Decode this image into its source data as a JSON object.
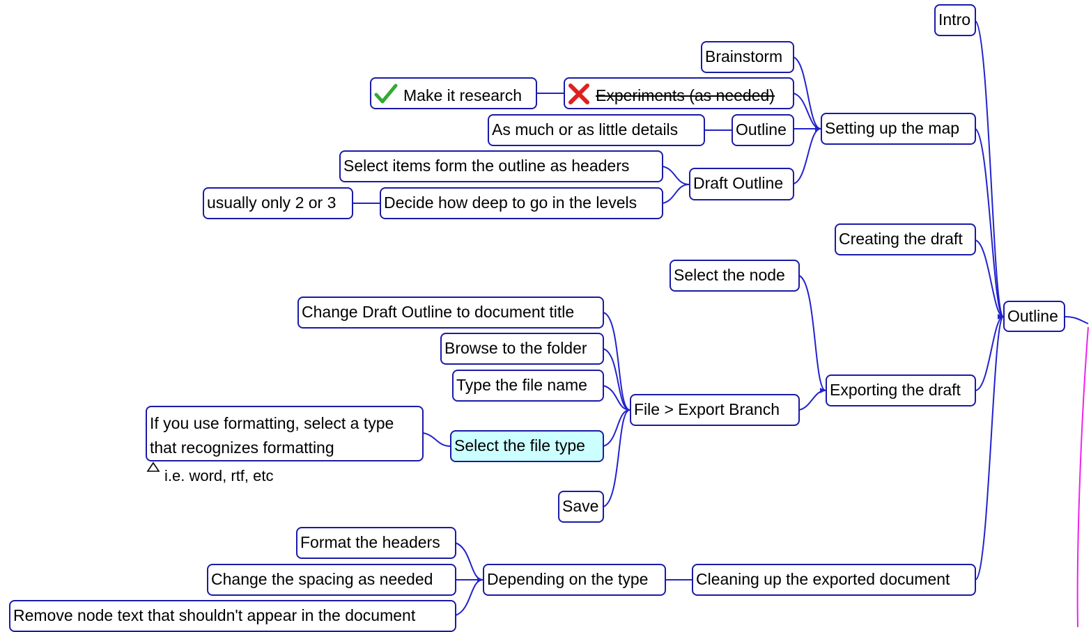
{
  "root": {
    "label": "Outline"
  },
  "branches": {
    "intro": "Intro",
    "setup": "Setting up the map",
    "creating": "Creating the draft",
    "exporting": "Exporting the draft",
    "cleaning": "Cleaning up the exported document"
  },
  "setup_children": {
    "brainstorm": "Brainstorm",
    "experiments": "Experiments (as needed)",
    "make_research": "Make it research",
    "outline": "Outline",
    "details": "As much or as little details",
    "draft_outline": "Draft Outline",
    "select_headers": "Select items form the outline as headers",
    "decide_levels": "Decide how deep to go in the levels",
    "usually": "usually only 2 or 3"
  },
  "export_children": {
    "select_node": "Select the node",
    "export_branch": "File > Export Branch",
    "change_title": "Change Draft Outline to document title",
    "browse": "Browse to the folder",
    "type_name": "Type the file name",
    "select_type": "Select the file type",
    "formatting_tip": "If you use formatting, select a type that recognizes formatting",
    "formatting_note": "i.e. word, rtf, etc",
    "save": "Save"
  },
  "clean_children": {
    "depending": "Depending on the type",
    "format_headers": "Format the headers",
    "spacing": "Change the spacing as needed",
    "remove_text": "Remove node text that shouldn't appear in the document"
  },
  "icons": {
    "make_research": "checkmark-icon",
    "experiments": "cross-icon",
    "note": "note-triangle-icon"
  },
  "colors": {
    "node_border": "#1a1aa6",
    "edge": "#2222cc",
    "selected_fill": "#ccffff",
    "connector_right": "#ee22ee",
    "check": "#33aa33",
    "cross": "#e02020"
  }
}
